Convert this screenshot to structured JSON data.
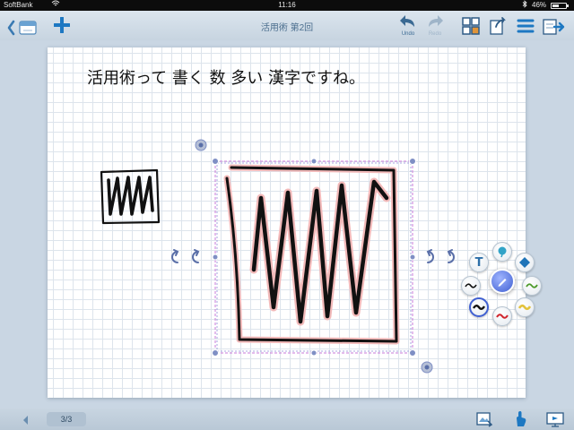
{
  "status_bar": {
    "carrier": "SoftBank",
    "time": "11:16",
    "battery": "46%",
    "battery_level": 0.46
  },
  "toolbar": {
    "title": "活用術 第2回",
    "undo_label": "Undo",
    "redo_label": "Redo"
  },
  "canvas": {
    "handwriting": "活用術って 書く 数 多い 漢字ですね。",
    "ink_color": "#111111",
    "selection_color": "#c879d8",
    "handle_color": "#7f8fc4"
  },
  "palette": {
    "text_tool": "T"
  },
  "bottom_bar": {
    "page_counter": "3/3"
  },
  "colors": {
    "accent": "#1d78c2",
    "toolbar": "#cfdbe6",
    "grid_line": "#dde4ec"
  }
}
